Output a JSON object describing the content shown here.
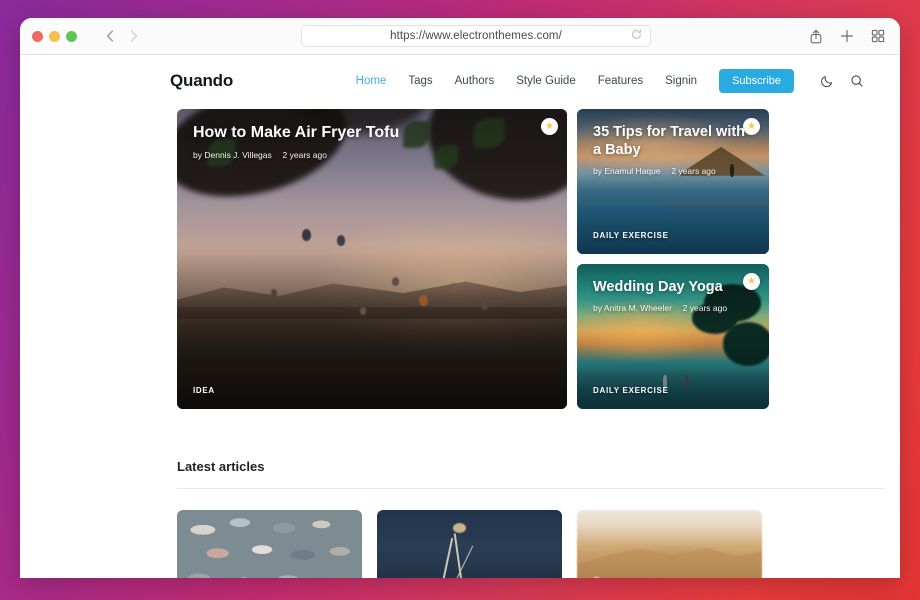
{
  "browser": {
    "url": "https://www.electronthemes.com/",
    "reload_icon": "reload-icon",
    "back_icon": "chevron-left-icon",
    "forward_icon": "chevron-right-icon",
    "share_icon": "share-icon",
    "new_tab_icon": "plus-icon",
    "tab_overview_icon": "grid-icon",
    "traffic_lights": [
      "close",
      "minimize",
      "maximize"
    ]
  },
  "site": {
    "brand": "Quando",
    "nav": [
      {
        "label": "Home",
        "active": true
      },
      {
        "label": "Tags",
        "active": false
      },
      {
        "label": "Authors",
        "active": false
      },
      {
        "label": "Style Guide",
        "active": false
      },
      {
        "label": "Features",
        "active": false
      },
      {
        "label": "Signin",
        "active": false
      }
    ],
    "subscribe_label": "Subscribe",
    "dark_mode_icon": "moon-icon",
    "search_icon": "search-icon",
    "accent_color": "#29abe2",
    "active_link_color": "#3eb0ef"
  },
  "hero": {
    "featured": {
      "title": "How to Make Air Fryer Tofu",
      "by_prefix": "by",
      "author": "Dennis J. Villegas",
      "time": "2 years ago",
      "tag": "IDEA",
      "starred": true
    },
    "secondary": [
      {
        "title": "35 Tips for Travel with a Baby",
        "by_prefix": "by",
        "author": "Enamul Haque",
        "time": "2 years ago",
        "tag": "DAILY EXERCISE",
        "starred": true
      },
      {
        "title": "Wedding Day Yoga",
        "by_prefix": "by",
        "author": "Anitra M. Wheeler",
        "time": "2 years ago",
        "tag": "DAILY EXERCISE",
        "starred": true
      }
    ]
  },
  "latest": {
    "heading": "Latest articles",
    "cards": [
      {
        "image_alt": "pebbles-beach-stones"
      },
      {
        "image_alt": "still-life-flowers-dark-blue"
      },
      {
        "image_alt": "desert-sand-dune"
      }
    ]
  }
}
